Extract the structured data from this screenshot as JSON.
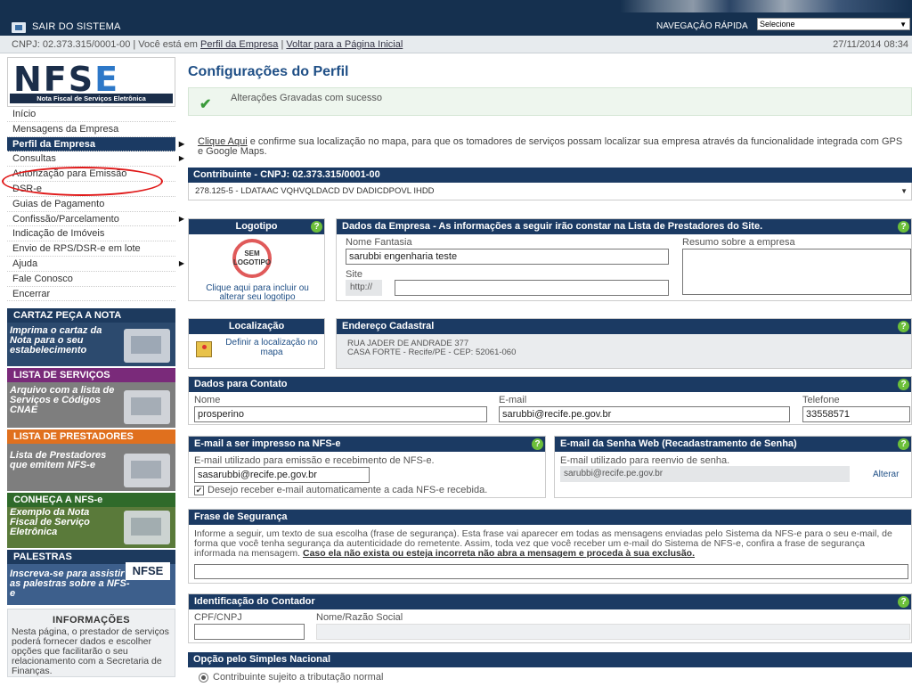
{
  "topbar": {
    "exit_label": "SAIR DO SISTEMA",
    "nav_label": "NAVEGAÇÃO RÁPIDA",
    "nav_select_value": "Selecione"
  },
  "infobar": {
    "cnpj_text": "CNPJ: 02.373.315/0001-00 | Você está em",
    "breadcrumb_current": "Perfil da Empresa",
    "separator": "|",
    "back_link": "Voltar para a Página Inicial",
    "datetime": "27/11/2014 08:34"
  },
  "logo": {
    "letters_dark": "NFS",
    "letter_accent": "E",
    "tagline": "Nota Fiscal de Serviços Eletrônica"
  },
  "menu": {
    "items": [
      {
        "label": "Início"
      },
      {
        "label": "Mensagens da Empresa"
      },
      {
        "label": "Perfil da Empresa"
      },
      {
        "label": "Consultas"
      },
      {
        "label": "Autorização para Emissão"
      },
      {
        "label": "DSR-e"
      },
      {
        "label": "Guias de Pagamento"
      },
      {
        "label": "Confissão/Parcelamento"
      },
      {
        "label": "Indicação de Imóveis"
      },
      {
        "label": "Envio de RPS/DSR-e em lote"
      },
      {
        "label": "Ajuda"
      },
      {
        "label": "Fale Conosco"
      },
      {
        "label": "Encerrar"
      }
    ]
  },
  "banners": {
    "cartaz": {
      "title": "CARTAZ PEÇA A NOTA",
      "text": "Imprima o cartaz da Nota para o seu estabelecimento"
    },
    "lista": {
      "title": "LISTA DE SERVIÇOS",
      "text": "Arquivo com a lista de Serviços e Códigos CNAE"
    },
    "prestadores": {
      "title": "LISTA DE PRESTADORES",
      "text": "Lista de Prestadores que emitem NFS-e"
    },
    "conheca": {
      "title": "CONHEÇA A NFS-e",
      "text": "Exemplo da Nota Fiscal de Serviço Eletrônica"
    },
    "palestras": {
      "title": "PALESTRAS",
      "text": "Inscreva-se para assistir as palestras sobre a NFS-e",
      "logo_text": "NFSE"
    }
  },
  "info": {
    "title": "INFORMAÇÕES",
    "text": "Nesta página, o prestador de serviços poderá fornecer dados e escolher opções que facilitarão o seu relacionamento com a Secretaria de Finanças."
  },
  "main": {
    "title": "Configurações do Perfil",
    "success_msg": "Alterações Gravadas com sucesso",
    "locate_link": "Clique Aqui",
    "locate_text": " e confirme sua localização no mapa, para que os tomadores de serviços possam localizar sua empresa através da funcionalidade integrada com GPS e Google Maps.",
    "contribuinte_head": "Contribuinte - CNPJ: 02.373.315/0001-00",
    "contribuinte_select": "278.125-5 - LDATAAC VQHVQLDACD DV DADICDPOVL IHDD",
    "logotipo_head": "Logotipo",
    "logo_placeholder_1": "SEM",
    "logo_placeholder_2": "LOGOTIPO",
    "logo_hint": "Clique aqui para incluir ou alterar seu logotipo",
    "dados_head": "Dados da Empresa - As informações a seguir irão constar na Lista de Prestadores do Site.",
    "nome_fantasia_label": "Nome Fantasia",
    "nome_fantasia_value": "sarubbi engenharia teste",
    "site_label": "Site",
    "site_prefix": "http://",
    "site_value": "",
    "resumo_label": "Resumo sobre a empresa",
    "resumo_value": "",
    "localizacao_head": "Localização",
    "localizacao_link": "Definir a localização no mapa",
    "endereco_head": "Endereço Cadastral",
    "endereco_line1": "RUA JADER DE ANDRADE 377",
    "endereco_line2": "CASA FORTE - Recife/PE - CEP: 52061-060",
    "contato_head": "Dados para Contato",
    "nome_label": "Nome",
    "nome_value": "prosperino",
    "email_label": "E-mail",
    "email_value": "sarubbi@recife.pe.gov.br",
    "telefone_label": "Telefone",
    "telefone_value": "33558571",
    "email_nfse_head": "E-mail a ser impresso na NFS-e",
    "email_nfse_label": "E-mail utilizado para emissão e recebimento de NFS-e.",
    "email_nfse_value": "sasarubbi@recife.pe.gov.br",
    "email_nfse_check": "Desejo receber e-mail automaticamente a cada NFS-e recebida.",
    "senha_head": "E-mail da Senha Web (Recadastramento de Senha)",
    "senha_label": "E-mail utilizado para reenvio de senha.",
    "senha_value": "sarubbi@recife.pe.gov.br",
    "senha_alterar": "Alterar",
    "frase_head": "Frase de Segurança",
    "frase_text": "Informe a seguir, um texto de sua escolha (frase de segurança). Esta frase vai aparecer em todas as mensagens enviadas pelo Sistema da NFS-e para o seu e-mail, de forma que você tenha segurança da autenticidade do remetente. Assim, toda vez que você receber um e-mail do Sistema de NFS-e, confira a frase de segurança informada na mensagem. ",
    "frase_warning": "Caso ela não exista ou esteja incorreta não abra a mensagem e proceda à sua exclusão.",
    "frase_value": "",
    "contador_head": "Identificação do Contador",
    "cpf_label": "CPF/CNPJ",
    "cpf_value": "",
    "razao_label": "Nome/Razão Social",
    "razao_value": "",
    "simples_head": "Opção pelo Simples Nacional",
    "simples_option": "Contribuinte sujeito a tributação normal"
  }
}
